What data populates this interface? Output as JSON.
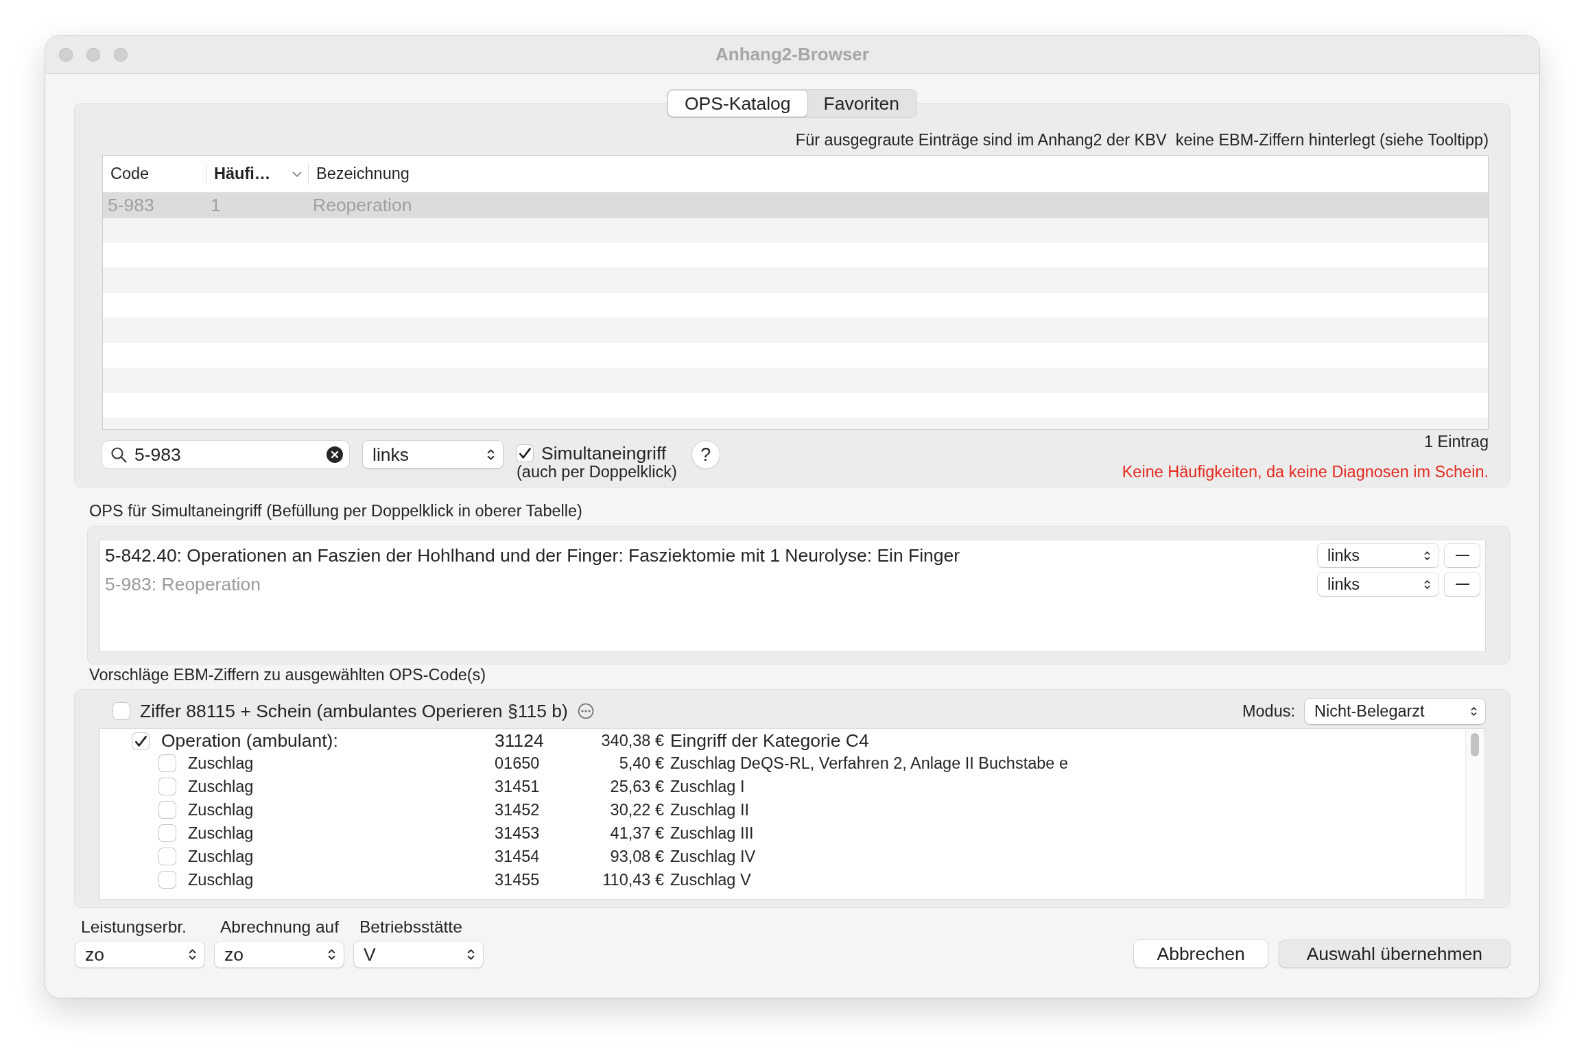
{
  "window": {
    "title": "Anhang2-Browser"
  },
  "tabs": [
    {
      "label": "OPS-Katalog",
      "selected": true
    },
    {
      "label": "Favoriten",
      "selected": false
    }
  ],
  "catalog": {
    "info": "Für ausgegraute Einträge sind im Anhang2 der KBV  keine EBM-Ziffern hinterlegt (siehe Tooltipp)",
    "table": {
      "columns": [
        {
          "label": "Code",
          "sorted": false
        },
        {
          "label": "Häufi…",
          "sorted": true
        },
        {
          "label": "Bezeichnung",
          "sorted": false
        }
      ],
      "rows": [
        {
          "cells": [
            "5-983",
            "1",
            "Reoperation"
          ],
          "selected": true,
          "greyed": true
        }
      ]
    },
    "search": {
      "value": "5-983"
    },
    "side": {
      "value": "links"
    },
    "simultaneous": {
      "label": "Simultaneingriff",
      "hint": "(auch per Doppelklick)",
      "checked": true
    },
    "help": {
      "label": "?"
    },
    "count": "1 Eintrag",
    "warning": "Keine Häufigkeiten, da keine Diagnosen im Schein."
  },
  "simultaneous_ops": {
    "label": "OPS für Simultaneingriff (Befüllung per Doppelklick in oberer Tabelle)",
    "items": [
      {
        "text": "5-842.40: Operationen an Faszien der Hohlhand und der Finger: Fasziektomie mit 1 Neurolyse: Ein Finger",
        "greyed": false,
        "side": "links"
      },
      {
        "text": "5-983: Reoperation",
        "greyed": true,
        "side": "links"
      }
    ]
  },
  "ebm": {
    "label": "Vorschläge EBM-Ziffern zu ausgewählten OPS-Code(s)",
    "flat_rate": {
      "label": "Ziffer 88115 + Schein (ambulantes Operieren §115 b)",
      "checked": false
    },
    "mode": {
      "label": "Modus:",
      "value": "Nicht-Belegarzt"
    },
    "items": [
      {
        "label": "Operation (ambulant):",
        "code": "31124",
        "amount": "340,38 €",
        "description": "Eingriff der Kategorie C4",
        "checked": true,
        "children": [
          {
            "label": "Zuschlag",
            "code": "01650",
            "amount": "5,40 €",
            "description": "Zuschlag DeQS-RL, Verfahren 2, Anlage II Buchstabe e",
            "checked": false
          },
          {
            "label": "Zuschlag",
            "code": "31451",
            "amount": "25,63 €",
            "description": "Zuschlag I",
            "checked": false
          },
          {
            "label": "Zuschlag",
            "code": "31452",
            "amount": "30,22 €",
            "description": "Zuschlag II",
            "checked": false
          },
          {
            "label": "Zuschlag",
            "code": "31453",
            "amount": "41,37 €",
            "description": "Zuschlag III",
            "checked": false
          },
          {
            "label": "Zuschlag",
            "code": "31454",
            "amount": "93,08 €",
            "description": "Zuschlag IV",
            "checked": false
          },
          {
            "label": "Zuschlag",
            "code": "31455",
            "amount": "110,43 €",
            "description": "Zuschlag V",
            "checked": false
          }
        ]
      }
    ]
  },
  "billing": [
    {
      "label": "Leistungserbr.",
      "value": "zo"
    },
    {
      "label": "Abrechnung auf",
      "value": "zo"
    },
    {
      "label": "Betriebsstätte",
      "value": "V"
    }
  ],
  "buttons": [
    {
      "label": "Abbrechen",
      "default": false
    },
    {
      "label": "Auswahl übernehmen",
      "default": true
    }
  ]
}
